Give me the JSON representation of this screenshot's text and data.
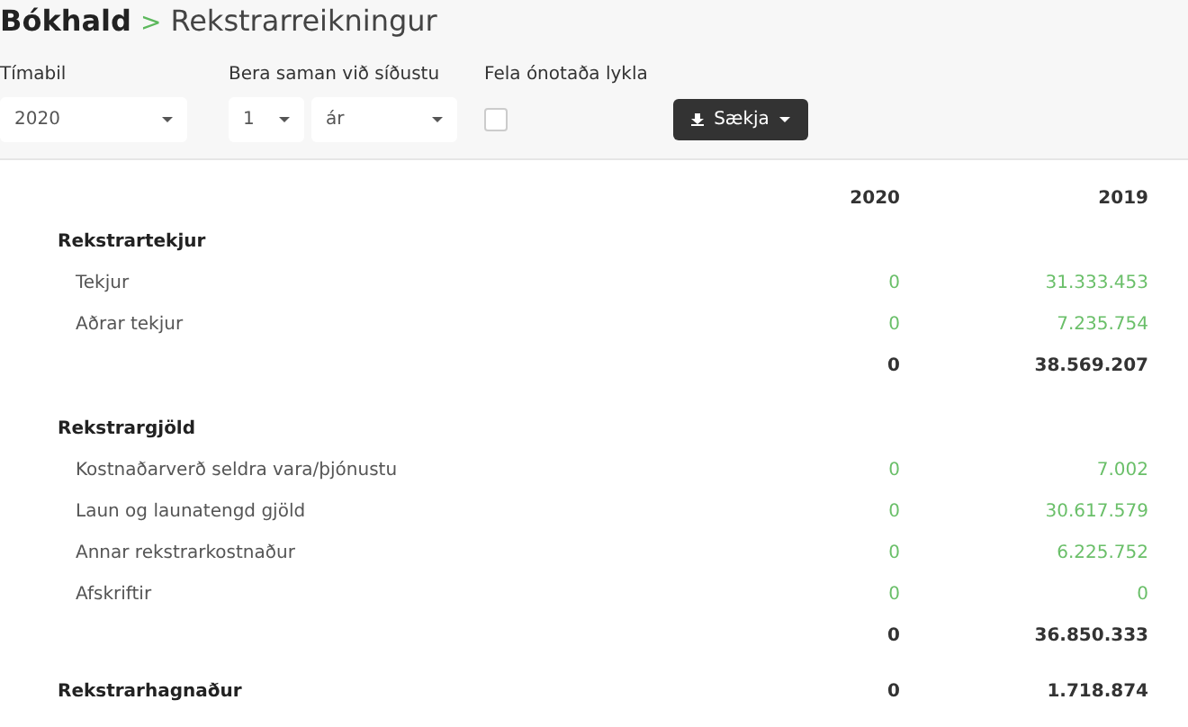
{
  "breadcrumb": {
    "parent": "Bókhald",
    "separator": ">",
    "current": "Rekstrarreikningur"
  },
  "filters": {
    "period": {
      "label": "Tímabil",
      "value": "2020"
    },
    "compare": {
      "label": "Bera saman við síðustu",
      "count": "1",
      "unit": "ár"
    },
    "hide_unused": {
      "label": "Fela ónotaða lykla",
      "checked": false
    },
    "fetch_button": "Sækja"
  },
  "table": {
    "columns": [
      "2020",
      "2019"
    ],
    "rows": [
      {
        "kind": "section",
        "label": "Rekstrartekjur"
      },
      {
        "kind": "item",
        "label": "Tekjur",
        "values": [
          "0",
          "31.333.453"
        ]
      },
      {
        "kind": "item",
        "label": "Aðrar tekjur",
        "values": [
          "0",
          "7.235.754"
        ]
      },
      {
        "kind": "total",
        "values": [
          "0",
          "38.569.207"
        ]
      },
      {
        "kind": "section",
        "label": "Rekstrargjöld"
      },
      {
        "kind": "item",
        "label": "Kostnaðarverð seldra vara/þjónustu",
        "values": [
          "0",
          "7.002"
        ]
      },
      {
        "kind": "item",
        "label": "Laun og launatengd gjöld",
        "values": [
          "0",
          "30.617.579"
        ]
      },
      {
        "kind": "item",
        "label": "Annar rekstrarkostnaður",
        "values": [
          "0",
          "6.225.752"
        ]
      },
      {
        "kind": "item",
        "label": "Afskriftir",
        "values": [
          "0",
          "0"
        ]
      },
      {
        "kind": "total",
        "values": [
          "0",
          "36.850.333"
        ]
      },
      {
        "kind": "result",
        "label": "Rekstrarhagnaður",
        "values": [
          "0",
          "1.718.874"
        ]
      }
    ]
  }
}
